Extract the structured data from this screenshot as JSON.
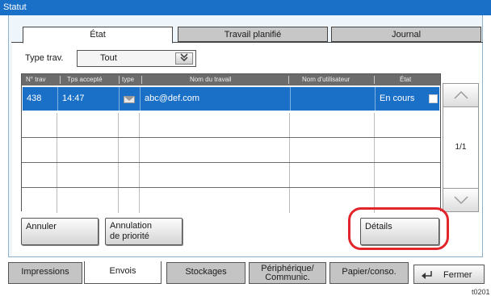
{
  "window": {
    "title": "Statut"
  },
  "tabs": [
    {
      "label": "État"
    },
    {
      "label": "Travail planifié"
    },
    {
      "label": "Journal"
    }
  ],
  "filter": {
    "label": "Type trav.",
    "value": "Tout"
  },
  "table": {
    "headers": [
      "N° trav",
      "Tps accepté",
      "type",
      "Nom du travail",
      "Nom d'utilisateur",
      "État"
    ],
    "rows": [
      {
        "job_no": "438",
        "time": "14:47",
        "type_icon": "envelope-icon",
        "job_name": "abc@def.com",
        "user": "",
        "state": "En cours",
        "selected": true
      },
      {
        "job_no": "",
        "time": "",
        "type_icon": "",
        "job_name": "",
        "user": "",
        "state": ""
      },
      {
        "job_no": "",
        "time": "",
        "type_icon": "",
        "job_name": "",
        "user": "",
        "state": ""
      },
      {
        "job_no": "",
        "time": "",
        "type_icon": "",
        "job_name": "",
        "user": "",
        "state": ""
      },
      {
        "job_no": "",
        "time": "",
        "type_icon": "",
        "job_name": "",
        "user": "",
        "state": ""
      }
    ]
  },
  "pager": {
    "text": "1/1"
  },
  "buttons": {
    "cancel": "Annuler",
    "priority_line1": "Annulation",
    "priority_line2": "de priorité",
    "details": "Détails"
  },
  "bottom_tabs": [
    {
      "label": "Impressions"
    },
    {
      "label": "Envois"
    },
    {
      "label": "Stockages"
    },
    {
      "label_line1": "Périphérique/",
      "label_line2": "Communic."
    },
    {
      "label": "Papier/conso."
    }
  ],
  "close": {
    "label": "Fermer"
  },
  "figure_code": "t0201",
  "colors": {
    "accent": "#1a70c6",
    "highlight": "#e2242b"
  }
}
